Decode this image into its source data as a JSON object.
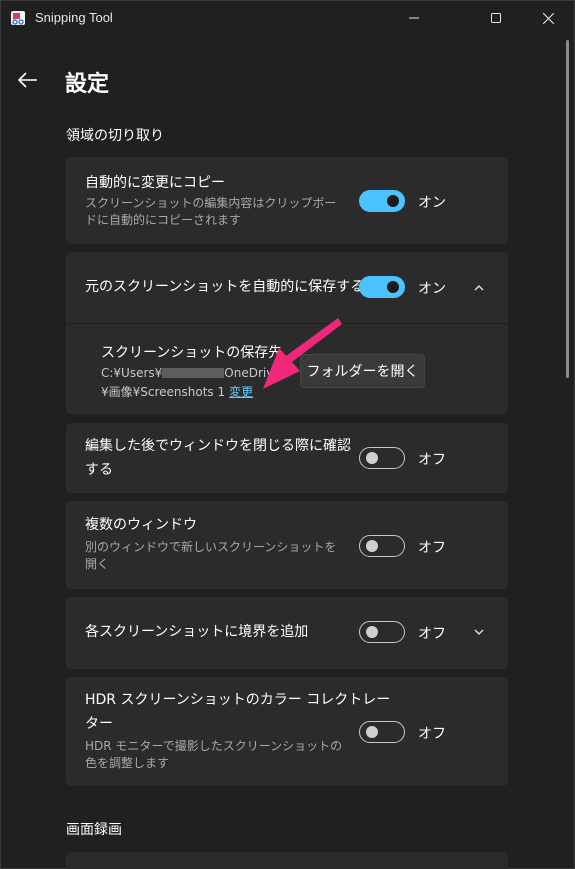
{
  "window": {
    "title": "Snipping Tool",
    "minimize_icon": "minimize-icon",
    "maximize_icon": "maximize-icon",
    "close_icon": "close-icon"
  },
  "header": {
    "back_icon": "arrow-left-icon",
    "title": "設定"
  },
  "sections": {
    "snip_title": "領域の切り取り",
    "record_title": "画面録画"
  },
  "settings": {
    "auto_copy": {
      "title": "自動的に変更にコピー",
      "desc_line1": "スクリーンショットの編集内容はクリップボー",
      "desc_line2": "ドに自動的にコピーされます",
      "state": "オン"
    },
    "auto_save": {
      "title": "元のスクリーンショットを自動的に保存する",
      "state": "オン",
      "chevron": "chevron-up-icon"
    },
    "save_location": {
      "title": "スクリーンショットの保存先",
      "path_prefix": "C:¥Users¥",
      "path_suffix": "OneDrive",
      "path_line2": "¥画像¥Screenshots 1",
      "change_link": "変更",
      "open_folder": "フォルダーを開く"
    },
    "confirm_close": {
      "title_line1": "編集した後でウィンドウを閉じる際に確認",
      "title_line2": "する",
      "state": "オフ"
    },
    "multi_window": {
      "title": "複数のウィンドウ",
      "desc_line1": "別のウィンドウで新しいスクリーンショットを",
      "desc_line2": "開く",
      "state": "オフ"
    },
    "border": {
      "title": "各スクリーンショットに境界を追加",
      "state": "オフ",
      "chevron": "chevron-down-icon"
    },
    "hdr": {
      "title_line1": "HDR スクリーンショットのカラー コレクトレー",
      "title_line2": "ター",
      "desc_line1": "HDR モニターで撮影したスクリーンショットの",
      "desc_line2": "色を調整します",
      "state": "オフ"
    }
  },
  "colors": {
    "accent": "#4cc2ff",
    "link": "#60cdff",
    "annotation_arrow": "#f0287a"
  }
}
